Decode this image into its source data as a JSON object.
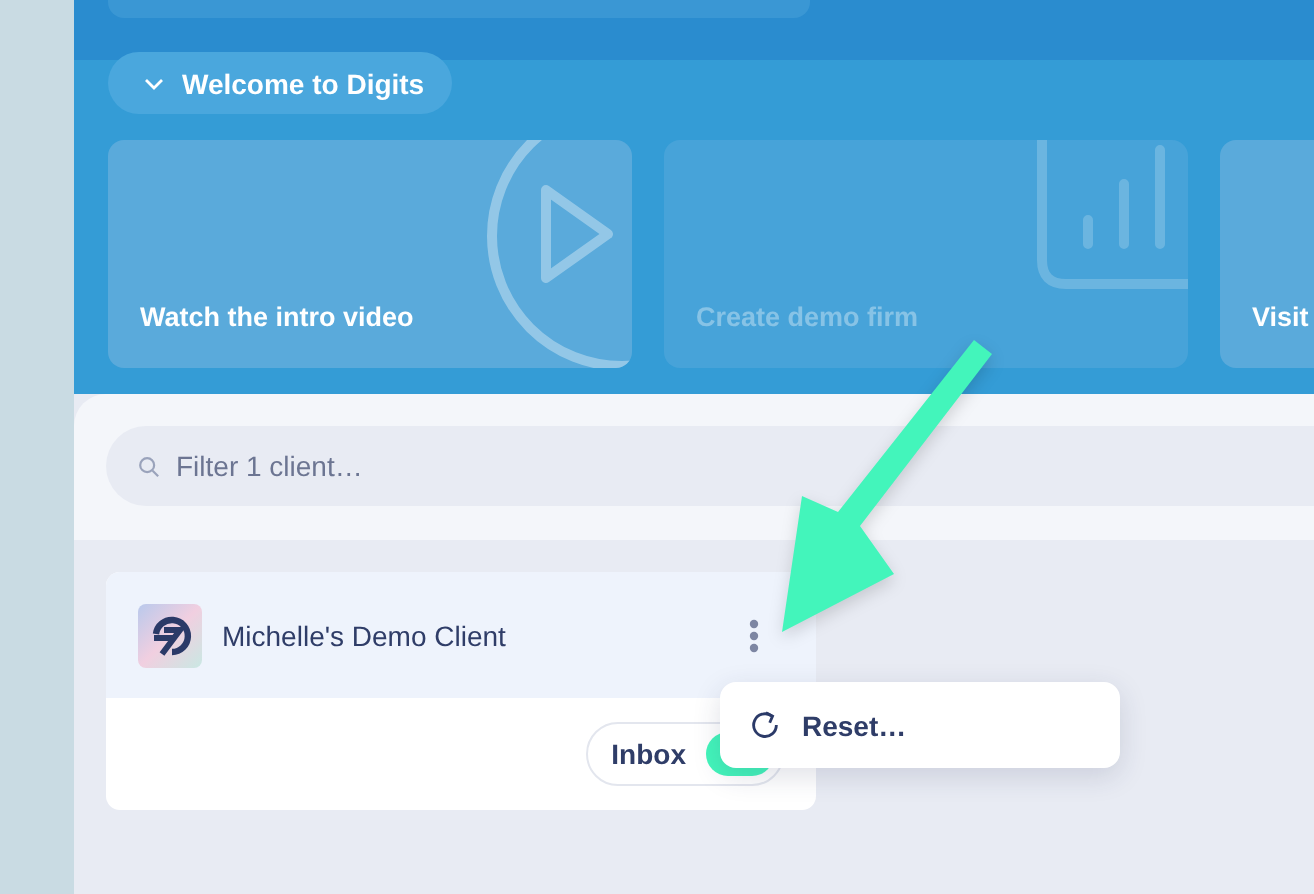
{
  "welcome": {
    "label": "Welcome to Digits",
    "expanded": true
  },
  "cards": [
    {
      "label": "Watch the intro video",
      "kind": "video",
      "disabled": false
    },
    {
      "label": "Create demo firm",
      "kind": "chart",
      "disabled": true
    },
    {
      "label": "Visit",
      "kind": "other",
      "disabled": false
    }
  ],
  "filter": {
    "placeholder": "Filter 1 client…"
  },
  "clients": [
    {
      "name": "Michelle's Demo Client",
      "toggle": {
        "label": "Inbox",
        "on": true
      }
    }
  ],
  "menu": {
    "items": [
      {
        "label": "Reset…"
      }
    ]
  }
}
